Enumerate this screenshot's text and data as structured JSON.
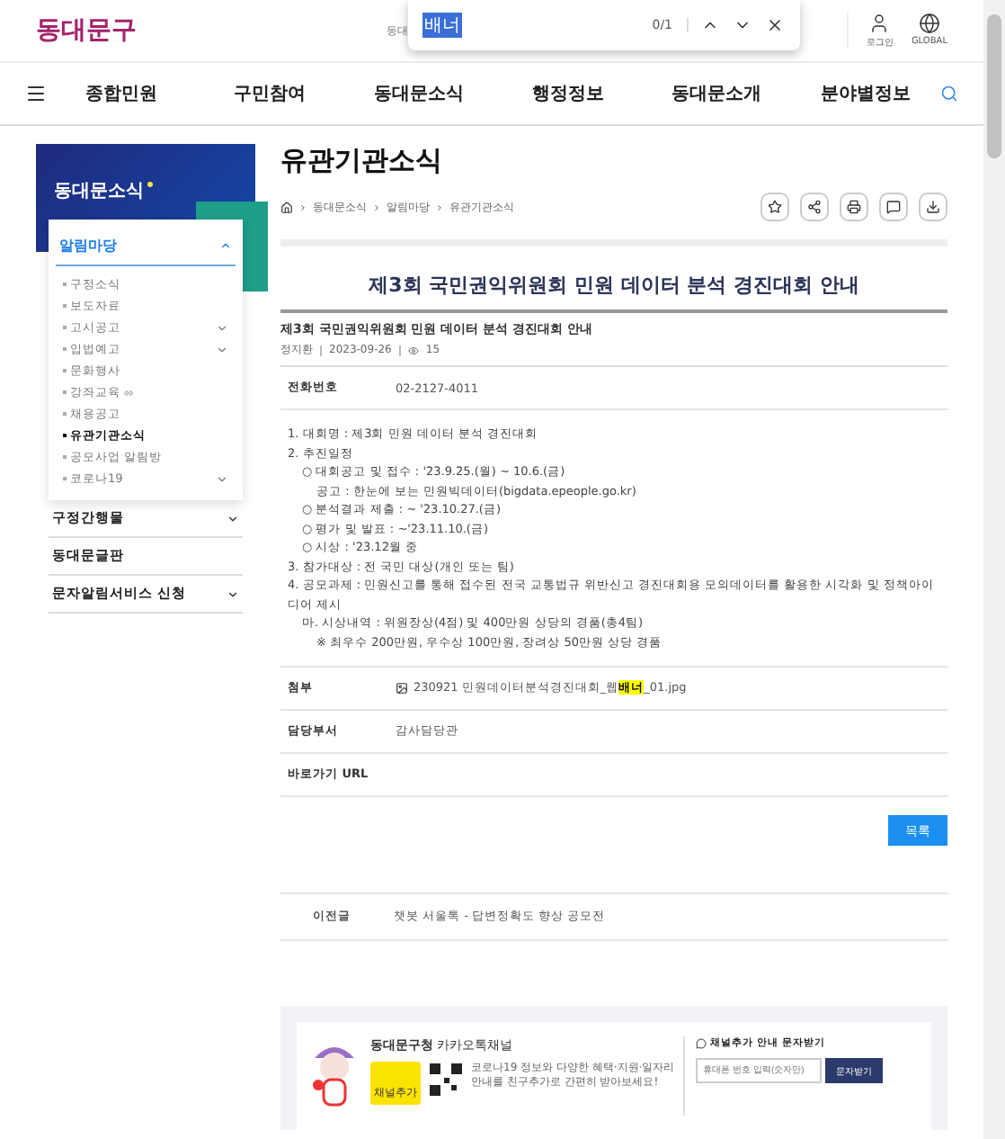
{
  "header": {
    "logo": "동대문구",
    "search_hint": "동대",
    "find_bar": {
      "query": "배너",
      "count": "0/1"
    },
    "utilities": [
      {
        "kind": "user",
        "label": "로그인"
      },
      {
        "kind": "globe",
        "label": "GLOBAL"
      }
    ]
  },
  "nav": {
    "items": [
      "종합민원",
      "구민참여",
      "동대문소식",
      "행정정보",
      "동대문소개",
      "분야별정보"
    ]
  },
  "sidebar": {
    "title": "동대문소식",
    "menu": [
      {
        "label": "알림마당",
        "expanded": true,
        "expandable": true,
        "children": [
          {
            "label": "구정소식",
            "selected": false,
            "expandable": false
          },
          {
            "label": "보도자료",
            "selected": false,
            "expandable": false
          },
          {
            "label": "고시공고",
            "selected": false,
            "expandable": true
          },
          {
            "label": "입법예고",
            "selected": false,
            "expandable": true
          },
          {
            "label": "문화행사",
            "selected": false,
            "expandable": false
          },
          {
            "label": "강좌교육",
            "selected": false,
            "expandable": false,
            "external": true
          },
          {
            "label": "채용공고",
            "selected": false,
            "expandable": false
          },
          {
            "label": "유관기관소식",
            "selected": true,
            "expandable": false
          },
          {
            "label": "공모사업 알림방",
            "selected": false,
            "expandable": false
          },
          {
            "label": "코로나19",
            "selected": false,
            "expandable": true
          }
        ]
      },
      {
        "label": "구정간행물",
        "expanded": false,
        "expandable": true
      },
      {
        "label": "동대문글판",
        "expandable": false
      },
      {
        "label": "문자알림서비스 신청",
        "expanded": false,
        "expandable": true
      }
    ]
  },
  "page": {
    "title": "유관기관소식",
    "breadcrumb": [
      "동대문소식",
      "알림마당",
      "유관기관소식"
    ],
    "actions": [
      {
        "kind": "star"
      },
      {
        "kind": "share"
      },
      {
        "kind": "print"
      },
      {
        "kind": "feedback"
      },
      {
        "kind": "download"
      }
    ]
  },
  "article": {
    "heading": "제3회 국민권익위원회 민원 데이터 분석 경진대회 안내",
    "subtitle": "제3회 국민권익위원회 민원 데이터 분석 경진대회 안내",
    "meta": {
      "author": "정지환",
      "date": "2023-09-26",
      "views": "15"
    },
    "phone": {
      "label": "전화번호",
      "value": "02-2127-4011"
    },
    "body": [
      {
        "text": "1. 대회명 : 제3회 민원 데이터 분석 경진대회"
      },
      {
        "text": "2. 추진일정",
        "children": [
          {
            "text": "○ 대회공고 및 접수 : '23.9.25.(월) ~ 10.6.(금)",
            "children": [
              {
                "text": "공고 : 한눈에 보는 민원빅데이터(bigdata.epeople.go.kr)"
              }
            ]
          },
          {
            "text": "○ 분석결과 제출 : ~ '23.10.27.(금)"
          },
          {
            "text": "○ 평가 및 발표 : ~'23.11.10.(금)"
          },
          {
            "text": "○ 시상 : '23.12월 중"
          }
        ]
      },
      {
        "text": "3. 참가대상 : 전 국민 대상(개인 또는 팀)"
      },
      {
        "text": "4. 공모과제 : 민원신고를 통해 접수된 전국 교통법규 위반신고 경진대회용 모의데이터를 활용한 시각화 및 정책아이디어 제시",
        "children": [
          {
            "text": "마. 시상내역 : 위원장상(4점) 및 400만원 상당의 경품(총4팀)",
            "children": [
              {
                "text": "※ 최우수 200만원, 우수상 100만원, 장려상 50만원 상당 경품"
              }
            ]
          }
        ]
      }
    ],
    "attachment": {
      "label": "첨부",
      "before": "230921 민원데이터분석경진대회_웹",
      "match": "배너",
      "after": "_01.jpg"
    },
    "department": {
      "label": "담당부서",
      "value": "감사담당관"
    },
    "url": {
      "label": "바로가기 URL"
    },
    "list_button": "목록",
    "prev": {
      "label": "이전글",
      "title": "챗봇 서울톡 - 답변정확도 향상 공모전"
    }
  },
  "kakao": {
    "title_bold": "동대문구청",
    "title_rest": "카카오톡채널",
    "badge": "채널추가",
    "desc": [
      "코로나19 정보와 다양한 혜택·지원·일자리",
      "안내를 친구추가로 간편히 받아보세요!"
    ],
    "sms_title": "채널추가 안내 문자받기",
    "placeholder": "휴대폰 번호 입력(숫자만)",
    "sms_button": "문자받기"
  }
}
